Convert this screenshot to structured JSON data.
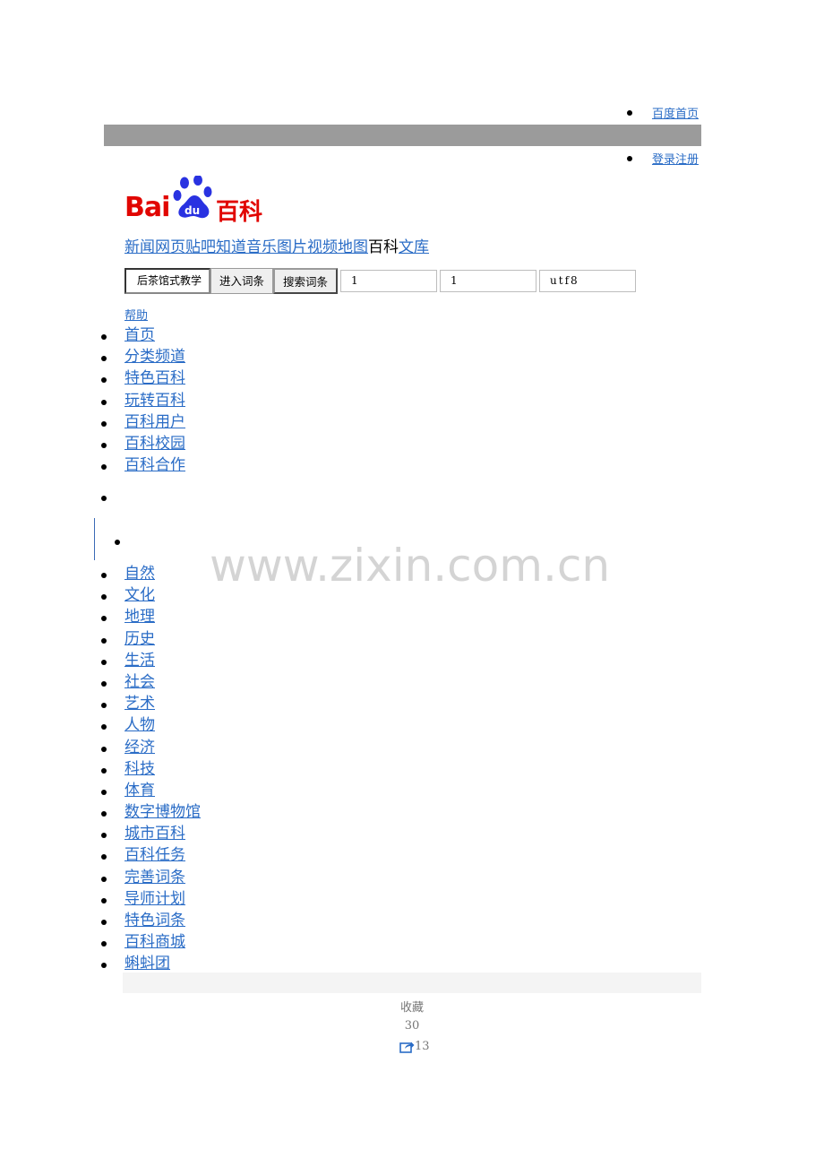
{
  "top_links": {
    "home": "百度首页",
    "login": "登录注册"
  },
  "logo": {
    "brand": "Bai",
    "du": "du",
    "product": "百科"
  },
  "product_nav": [
    {
      "label": "新闻",
      "current": false
    },
    {
      "label": "网页",
      "current": false
    },
    {
      "label": "贴吧",
      "current": false
    },
    {
      "label": "知道",
      "current": false
    },
    {
      "label": "音乐",
      "current": false
    },
    {
      "label": "图片",
      "current": false
    },
    {
      "label": "视频",
      "current": false
    },
    {
      "label": "地图",
      "current": false
    },
    {
      "label": "百科",
      "current": true
    },
    {
      "label": "文库",
      "current": false
    }
  ],
  "search": {
    "query": "后茶馆式教学",
    "enter_button": "进入词条",
    "search_button": "搜索词条",
    "field1": "1",
    "field2": "1",
    "field3": "utf8"
  },
  "help": "帮助",
  "main_nav": [
    "首页",
    "分类频道",
    "特色百科",
    "玩转百科",
    "百科用户",
    "百科校园",
    "百科合作"
  ],
  "categories": [
    "自然",
    "文化",
    "地理",
    "历史",
    "生活",
    "社会",
    "艺术",
    "人物",
    "经济",
    "科技",
    "体育",
    "数字博物馆",
    "城市百科",
    "百科任务",
    "完善词条",
    "导师计划",
    "特色词条",
    "百科商城",
    "蝌蚪团"
  ],
  "watermark": "www.zixin.com.cn",
  "stats": {
    "collect_label": "收藏",
    "collect_count": "30",
    "share_count": "13"
  },
  "colors": {
    "link": "#2a6cc6",
    "brand_red": "#e10602",
    "gray_bar": "#9b9b9b"
  }
}
